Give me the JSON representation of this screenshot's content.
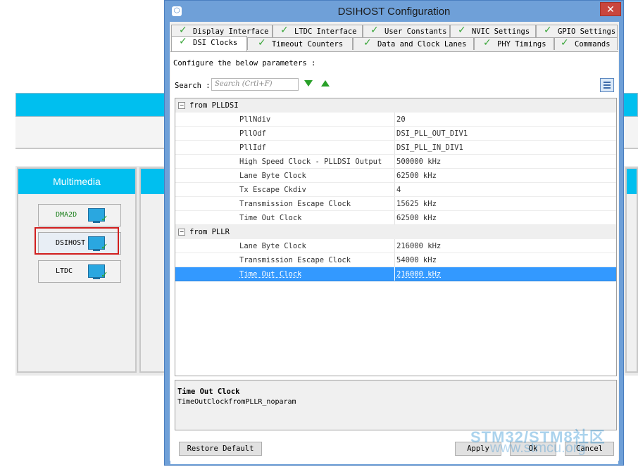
{
  "background": {
    "column_header": "Multimedia",
    "peripherals": [
      {
        "label": "DMA2D",
        "selected": false
      },
      {
        "label": "DSIHOST",
        "selected": true
      },
      {
        "label": "LTDC",
        "selected": false
      }
    ]
  },
  "dialog": {
    "title": "DSIHOST Configuration",
    "close_glyph": "✕",
    "tabs_row1": [
      "Display Interface",
      "LTDC Interface",
      "User Constants",
      "NVIC Settings",
      "GPIO Settings"
    ],
    "tabs_row2": [
      "DSI Clocks",
      "Timeout Counters",
      "Data and Clock Lanes",
      "PHY Timings",
      "Commands"
    ],
    "active_tab": "DSI Clocks",
    "subtitle": "Configure the below parameters :",
    "search": {
      "label": "Search :",
      "placeholder": "Search (Crtl+F)"
    },
    "groups": [
      {
        "name": "from PLLDSI",
        "params": [
          {
            "key": "PllNdiv",
            "value": "20"
          },
          {
            "key": "PllOdf",
            "value": "DSI_PLL_OUT_DIV1"
          },
          {
            "key": "PllIdf",
            "value": "DSI_PLL_IN_DIV1"
          },
          {
            "key": "High Speed Clock - PLLDSI Output",
            "value": "500000 kHz"
          },
          {
            "key": "Lane Byte Clock",
            "value": "62500 kHz"
          },
          {
            "key": "Tx Escape Ckdiv",
            "value": "4"
          },
          {
            "key": "Transmission Escape Clock",
            "value": "15625 kHz"
          },
          {
            "key": "Time Out Clock",
            "value": "62500 kHz"
          }
        ]
      },
      {
        "name": "from PLLR",
        "params": [
          {
            "key": "Lane Byte Clock",
            "value": "216000 kHz"
          },
          {
            "key": "Transmission Escape Clock",
            "value": "54000 kHz"
          },
          {
            "key": "Time Out Clock",
            "value": "216000 kHz",
            "selected": true
          }
        ]
      }
    ],
    "description": {
      "title": "Time Out Clock",
      "text": "TimeOutClockfromPLLR_noparam"
    },
    "buttons": {
      "restore": "Restore Default",
      "apply": "Apply",
      "ok": "Ok",
      "cancel": "Cancel"
    }
  },
  "watermark": {
    "line1": "STM32/STM8社区",
    "line2": "www.stmcu.org"
  }
}
